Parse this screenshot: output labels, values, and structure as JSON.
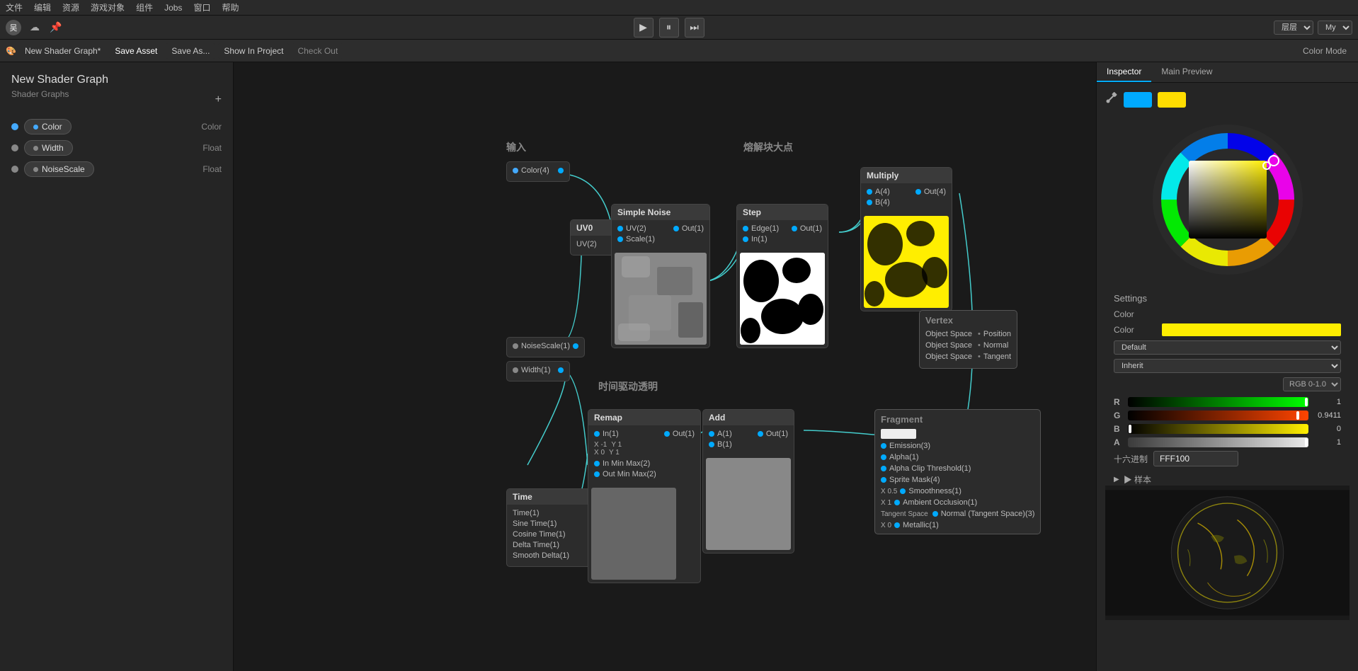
{
  "menuBar": {
    "items": [
      "文件",
      "编辑",
      "资源",
      "游戏对象",
      "组件",
      "Jobs",
      "窗口",
      "帮助"
    ]
  },
  "userBar": {
    "userName": "吴",
    "layerLabel": "层层",
    "myLabel": "My",
    "playButton": "▶",
    "pauseButton": "⏸",
    "stepButton": "⏭"
  },
  "toolbar": {
    "shaderName": "New Shader Graph*",
    "saveAsset": "Save Asset",
    "saveAs": "Save As...",
    "showInProject": "Show In Project",
    "checkOut": "Check Out",
    "colorMode": "Color Mode"
  },
  "leftPanel": {
    "shaderTitle": "New Shader Graph",
    "shaderSubtitle": "Shader Graphs",
    "properties": [
      {
        "name": "Color",
        "type": "Color",
        "dotColor": "#4af"
      },
      {
        "name": "Width",
        "type": "Float",
        "dotColor": "#888"
      },
      {
        "name": "NoiseScale",
        "type": "Float",
        "dotColor": "#888"
      }
    ]
  },
  "graphArea": {
    "sections": {
      "input": "输入",
      "dissolveNode": "熔解块大点",
      "timeDriven": "时间驱动透明"
    },
    "nodes": {
      "simpleNoise": "Simple Noise",
      "step": "Step",
      "multiply": "Multiply",
      "remap": "Remap",
      "add": "Add",
      "time": "Time",
      "uv": "UV0"
    },
    "ports": {
      "uv2": "UV(2)",
      "scale1": "Scale(1)",
      "out1": "Out(1)",
      "edge1": "Edge(1)",
      "in1": "In(1)",
      "a4": "A(4)",
      "b4": "B(4)",
      "out4": "Out(4)",
      "color4": "Color(4)",
      "noiseScale1": "NoiseScale(1)",
      "width1": "Width(1)",
      "inMinMax2": "In Min Max(2)",
      "outMinMax2": "Out Min Max(2)",
      "inPort": "In(1)",
      "outPort": "Out(1)",
      "a1": "A(1)",
      "b1": "B(1)"
    },
    "vertex": {
      "title": "Vertex",
      "objectSpace1": "Object Space",
      "position": "Position",
      "normal": "Normal",
      "tangent": "Tangent"
    },
    "fragment": {
      "title": "Fragment",
      "emission3": "Emission(3)",
      "alpha1": "Alpha(1)",
      "alphaClip1": "Alpha Clip Threshold(1)",
      "spritesMask4": "Sprite Mask(4)",
      "smoothness1": "Smoothness(1)",
      "ambientOcclusion1": "Ambient Occlusion(1)",
      "normalTangent3": "Normal (Tangent Space)(3)",
      "metallic1": "Metallic(1)"
    },
    "time": {
      "time1": "Time(1)",
      "sineTime1": "Sine Time(1)",
      "cosineTime1": "Cosine Time(1)",
      "deltaTime1": "Delta Time(1)",
      "smoothDelta1": "Smooth Delta(1)"
    },
    "xLabels": {
      "x0": "X 0",
      "x05": "X 0.5",
      "x1": "X 1",
      "x0b": "X 0",
      "xNeg1": "X -1",
      "y1a": "Y 1",
      "y1b": "Y 1"
    }
  },
  "rightPanel": {
    "tabs": [
      "Inspector",
      "Main Preview"
    ],
    "activeTab": "Inspector",
    "settingsTitle": "Settings",
    "colorSection": {
      "colorLabel": "Color",
      "colorValue": "Color",
      "colorSwatchHex": "#ffee00"
    },
    "colorPicker": {
      "eyedropperIcon": "💉",
      "swatchBlue": "#00aaff",
      "swatchYellow": "#ffdd00",
      "rgbMode": "RGB 0-1.0",
      "r": {
        "channel": "R",
        "value": "1"
      },
      "g": {
        "channel": "G",
        "value": "0.9411"
      },
      "b": {
        "channel": "B",
        "value": "0"
      },
      "a": {
        "channel": "A",
        "value": "1"
      },
      "hexLabel": "十六进制",
      "hexValue": "FFF100",
      "swatchLabel": "▶ 样本"
    },
    "inspector": {
      "defaultLabel": "Default",
      "inheritLabel": "Inherit"
    }
  }
}
